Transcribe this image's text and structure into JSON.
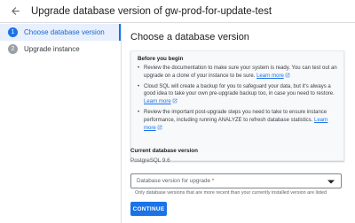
{
  "header": {
    "title": "Upgrade database version of gw-prod-for-update-test"
  },
  "sidebar": {
    "steps": [
      {
        "number": "1",
        "label": "Choose database version",
        "active": true
      },
      {
        "number": "2",
        "label": "Upgrade instance",
        "active": false
      }
    ]
  },
  "main": {
    "title": "Choose a database version",
    "info": {
      "heading": "Before you begin",
      "bullets": [
        {
          "text": "Review the documentation to make sure your system is ready. You can test out an upgrade on a clone of your instance to be sure. ",
          "link": "Learn more"
        },
        {
          "text": "Cloud SQL will create a backup for you to safeguard your data, but it's always a good idea to take your own pre-upgrade backup too, in case you need to restore. ",
          "link": "Learn more"
        },
        {
          "text": "Review the important post-upgrade steps you need to take to ensure instance performance, including running ANALYZE to refresh database statistics. ",
          "link": "Learn more"
        }
      ]
    },
    "current_version_label": "Current database version",
    "current_version_value": "PostgreSQL 9.6",
    "select": {
      "placeholder": "Database version for upgrade",
      "required_mark": "*",
      "hint": "Only database versions that are more recent than your currently installed version are listed"
    },
    "continue_label": "CONTINUE"
  },
  "colors": {
    "accent": "#1a73e8",
    "active_step_bg": "#e8f0fe",
    "required": "#d93025"
  }
}
